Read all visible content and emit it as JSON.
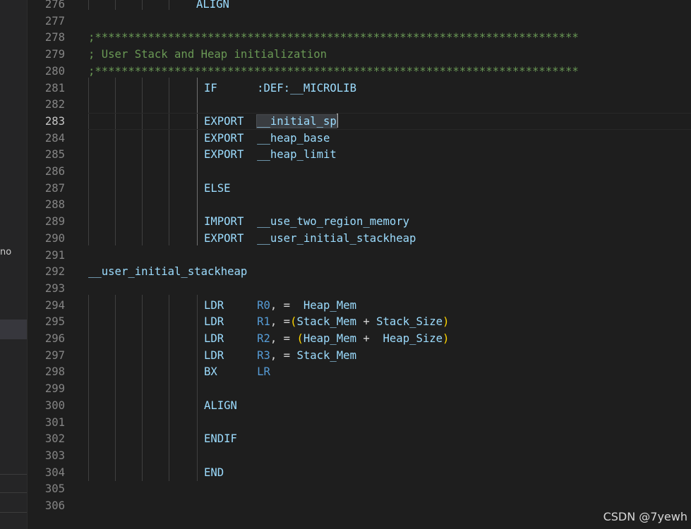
{
  "sidebar": {
    "cut_text": "no"
  },
  "editor": {
    "lines": [
      {
        "num": "276",
        "code": "                ALIGN"
      },
      {
        "num": "277",
        "code": ""
      },
      {
        "num": "278",
        "code": ";*************************************************************************"
      },
      {
        "num": "279",
        "code": "; User Stack and Heap initialization"
      },
      {
        "num": "280",
        "code": ";*************************************************************************"
      },
      {
        "num": "281",
        "code": "IF      :DEF:__MICROLIB"
      },
      {
        "num": "282",
        "code": ""
      },
      {
        "num": "283",
        "code": "EXPORT  __initial_sp",
        "selected": "__initial_sp"
      },
      {
        "num": "284",
        "code": "EXPORT  __heap_base"
      },
      {
        "num": "285",
        "code": "EXPORT  __heap_limit"
      },
      {
        "num": "286",
        "code": ""
      },
      {
        "num": "287",
        "code": "ELSE"
      },
      {
        "num": "288",
        "code": ""
      },
      {
        "num": "289",
        "code": "IMPORT  __use_two_region_memory"
      },
      {
        "num": "290",
        "code": "EXPORT  __user_initial_stackheap"
      },
      {
        "num": "291",
        "code": ""
      },
      {
        "num": "292",
        "code": "__user_initial_stackheap"
      },
      {
        "num": "293",
        "code": ""
      },
      {
        "num": "294",
        "code": "LDR     R0, =  Heap_Mem"
      },
      {
        "num": "295",
        "code": "LDR     R1, =(Stack_Mem + Stack_Size)"
      },
      {
        "num": "296",
        "code": "LDR     R2, = (Heap_Mem +  Heap_Size)"
      },
      {
        "num": "297",
        "code": "LDR     R3, = Stack_Mem"
      },
      {
        "num": "298",
        "code": "BX      LR"
      },
      {
        "num": "299",
        "code": ""
      },
      {
        "num": "300",
        "code": "ALIGN"
      },
      {
        "num": "301",
        "code": ""
      },
      {
        "num": "302",
        "code": "ENDIF"
      },
      {
        "num": "303",
        "code": ""
      },
      {
        "num": "304",
        "code": "END"
      },
      {
        "num": "305",
        "code": ""
      },
      {
        "num": "306",
        "code": ""
      }
    ],
    "active_line": "283"
  },
  "watermark": "CSDN @7yewh",
  "colors": {
    "background": "#1e1e1e",
    "comment": "#6a9955",
    "keyword": "#9cdcfe",
    "register": "#569cd6",
    "paren": "#ffd700",
    "line_number": "#858585"
  }
}
